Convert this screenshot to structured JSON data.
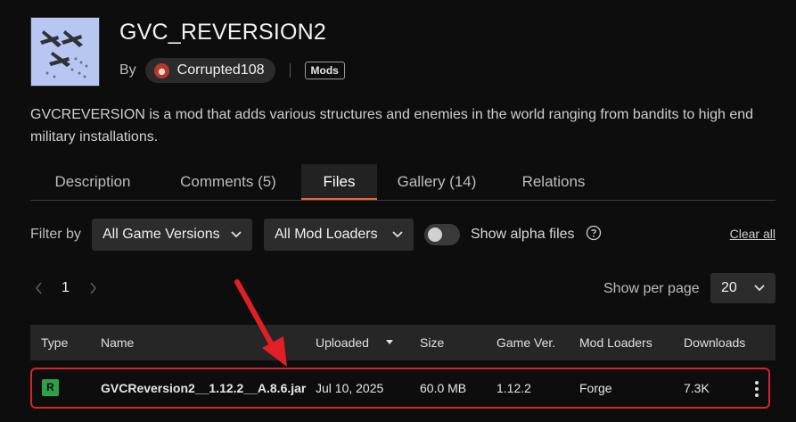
{
  "project": {
    "title": "GVC_REVERSION2",
    "by_label": "By",
    "author": "Corrupted108",
    "tag": "Mods",
    "description": "GVCREVERSION is a mod that adds various structures and enemies in the world ranging from bandits to high end military installations."
  },
  "tabs": [
    {
      "label": "Description",
      "active": false
    },
    {
      "label": "Comments (5)",
      "active": false
    },
    {
      "label": "Files",
      "active": true
    },
    {
      "label": "Gallery (14)",
      "active": false
    },
    {
      "label": "Relations",
      "active": false
    }
  ],
  "filters": {
    "label": "Filter by",
    "game_versions": "All Game Versions",
    "mod_loaders": "All Mod Loaders",
    "alpha_label": "Show alpha files",
    "alpha_enabled": false,
    "clear_all": "Clear all"
  },
  "pagination": {
    "current_page": "1",
    "per_page_label": "Show per page",
    "per_page_value": "20"
  },
  "table": {
    "headers": {
      "type": "Type",
      "name": "Name",
      "uploaded": "Uploaded",
      "size": "Size",
      "game_ver": "Game Ver.",
      "mod_loaders": "Mod Loaders",
      "downloads": "Downloads"
    },
    "rows": [
      {
        "type": "R",
        "name": "GVCReversion2__1.12.2__A.8.6.jar",
        "uploaded": "Jul 10, 2025",
        "size": "60.0 MB",
        "game_ver": "1.12.2",
        "mod_loader": "Forge",
        "downloads": "7.3K"
      }
    ]
  },
  "colors": {
    "accent": "#f16436",
    "release_badge": "#2ea04a",
    "highlight_box": "#d8232a",
    "annotation_arrow": "#e01f26"
  },
  "icons": {
    "chevron": "chevron-down-icon",
    "help": "help-circle-icon",
    "prev": "chevron-left-icon",
    "next": "chevron-right-icon",
    "menu": "kebab-menu-icon"
  }
}
